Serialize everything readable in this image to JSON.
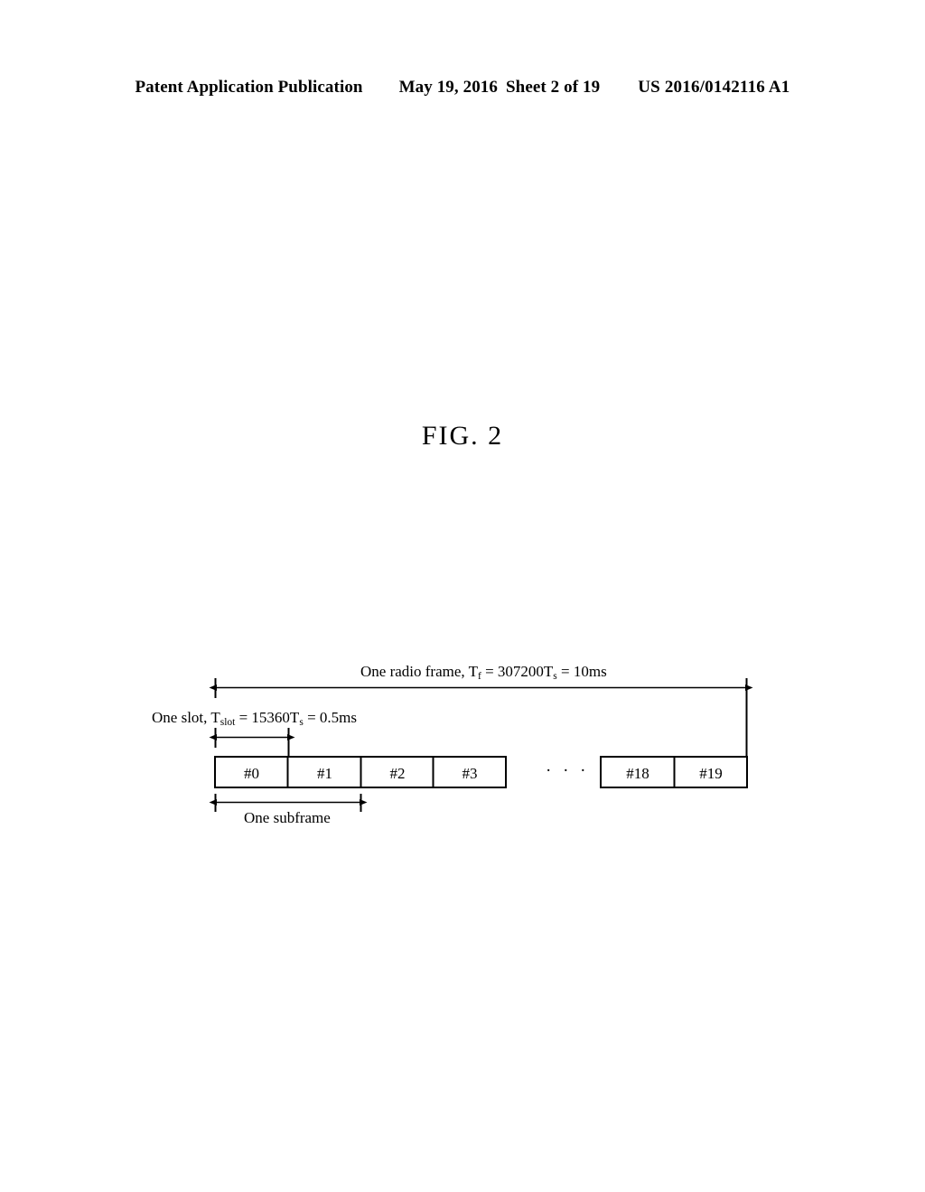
{
  "header": {
    "publication": "Patent Application Publication",
    "date": "May 19, 2016",
    "sheet": "Sheet 2 of 19",
    "patent_number": "US 2016/0142116 A1"
  },
  "figure": {
    "title": "FIG. 2",
    "labels": {
      "radio_frame_prefix": "One radio frame, T",
      "radio_frame_sub1": "f",
      "radio_frame_mid": " = 307200T",
      "radio_frame_sub2": "s",
      "radio_frame_suffix": " = 10ms",
      "radio_frame_full": "One radio frame, Tf = 307200Ts = 10ms",
      "slot_prefix": "One slot, T",
      "slot_sub1": "slot",
      "slot_mid": " = 15360T",
      "slot_sub2": "s",
      "slot_suffix": " = 0.5ms",
      "slot_full": "One slot, Tslot = 15360Ts = 0.5ms",
      "subframe": "One subframe",
      "ellipsis": "· · ·"
    },
    "slots": [
      {
        "label": "#0"
      },
      {
        "label": "#1"
      },
      {
        "label": "#2"
      },
      {
        "label": "#3"
      },
      {
        "label": "#18"
      },
      {
        "label": "#19"
      }
    ],
    "colors": {
      "ink": "#000000",
      "background": "#ffffff"
    }
  }
}
